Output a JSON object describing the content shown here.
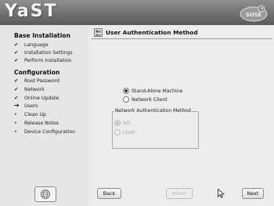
{
  "header": {
    "logo_text": "YaST",
    "suse_logo_text": "SUSE"
  },
  "sidebar": {
    "sections": [
      {
        "title": "Base Installation",
        "steps": [
          {
            "mark": "✔",
            "label": "Language"
          },
          {
            "mark": "✔",
            "label": "Installation Settings"
          },
          {
            "mark": "✔",
            "label": "Perform Installation"
          }
        ]
      },
      {
        "title": "Configuration",
        "steps": [
          {
            "mark": "✔",
            "label": "Root Password"
          },
          {
            "mark": "✔",
            "label": "Network"
          },
          {
            "mark": "✔",
            "label": "Online Update"
          },
          {
            "mark": "➜",
            "label": "Users"
          },
          {
            "mark": "•",
            "label": "Clean Up"
          },
          {
            "mark": "•",
            "label": "Release Notes"
          },
          {
            "mark": "•",
            "label": "Device Configuration"
          }
        ]
      }
    ]
  },
  "main": {
    "title": "User Authentication Method",
    "options": [
      {
        "label": "Stand-Alone Machine",
        "checked": true
      },
      {
        "label": "Network Client",
        "checked": false
      }
    ],
    "network_group": {
      "legend": "Network Authentication Method",
      "options": [
        {
          "label": "NIS",
          "checked": true
        },
        {
          "label": "LDAP",
          "checked": false
        }
      ]
    }
  },
  "buttons": {
    "back": "Back",
    "abort": "Abort",
    "next": "Next"
  }
}
